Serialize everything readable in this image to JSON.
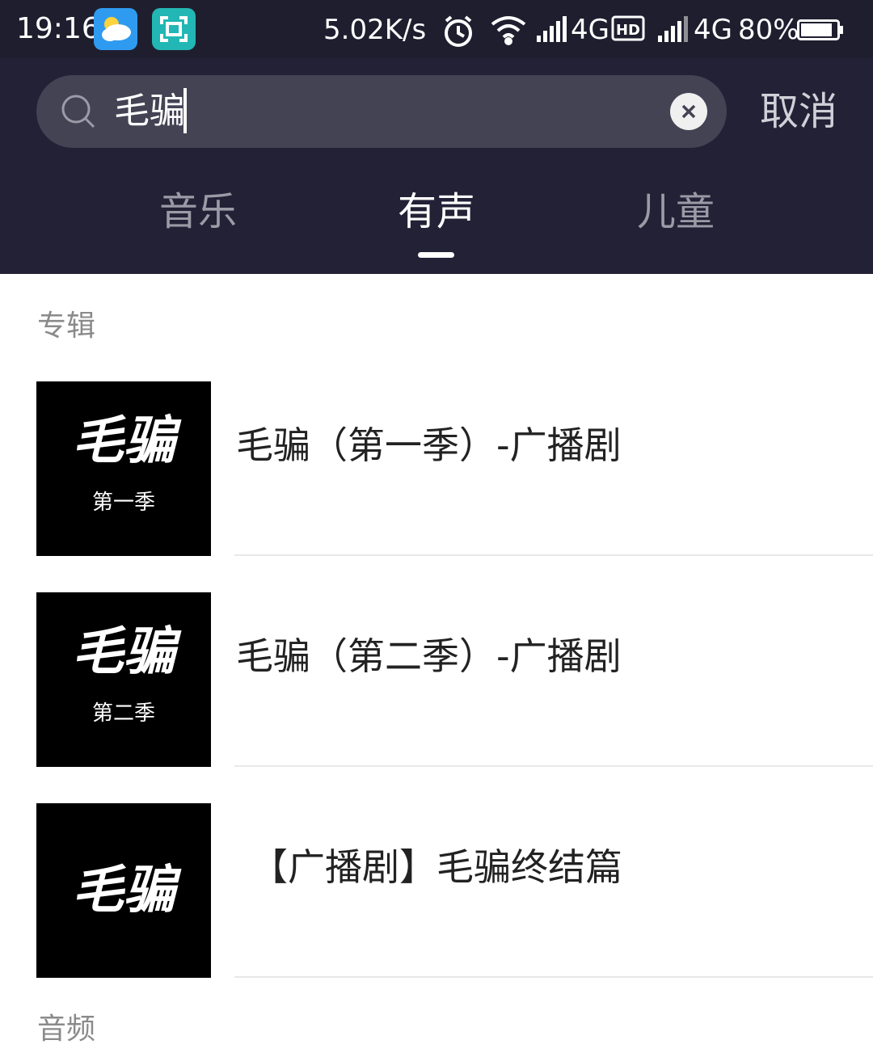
{
  "status_bar": {
    "time": "19:16",
    "speed": "5.02K/s",
    "network_1": "4G",
    "network_2": "4G",
    "battery": "80%"
  },
  "search": {
    "query": "毛骗",
    "cancel_label": "取消"
  },
  "tabs": [
    {
      "label": "音乐",
      "active": false
    },
    {
      "label": "有声",
      "active": true
    },
    {
      "label": "儿童",
      "active": false
    }
  ],
  "albums_section": {
    "title": "专辑",
    "items": [
      {
        "title": "毛骗（第一季）-广播剧",
        "cover_title": "毛骗",
        "cover_sub": "第一季"
      },
      {
        "title": "毛骗（第二季）-广播剧",
        "cover_title": "毛骗",
        "cover_sub": "第二季"
      },
      {
        "title": "【广播剧】毛骗终结篇",
        "cover_title": "毛骗",
        "cover_sub": ""
      }
    ]
  },
  "audio_section": {
    "title": "音频"
  },
  "colors": {
    "header_bg": "#222136",
    "status_bg": "#1f1e2f",
    "search_bg": "#444354",
    "active_tab": "#ffffff",
    "inactive_tab": "#9b9aa6"
  }
}
